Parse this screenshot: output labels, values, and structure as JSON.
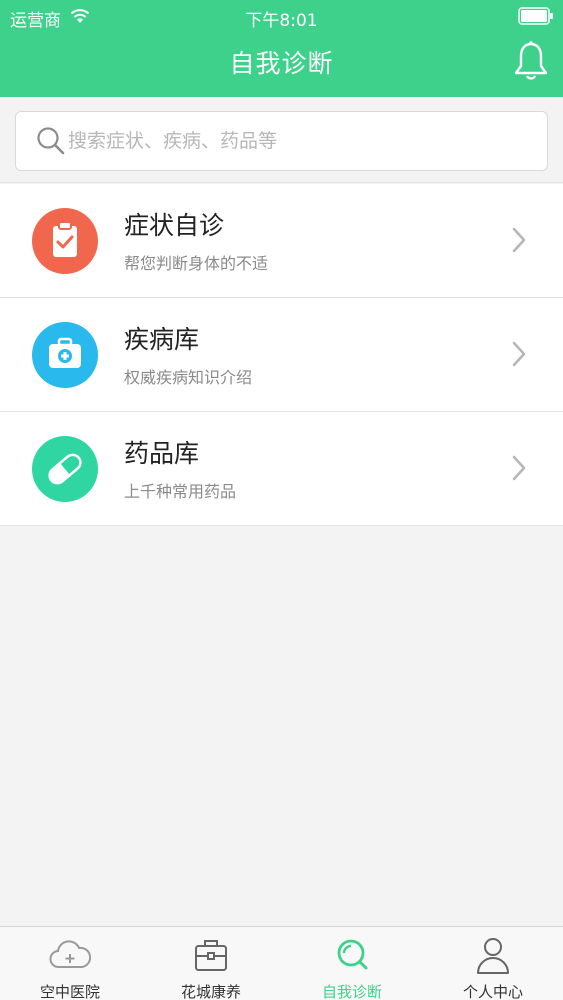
{
  "status_bar": {
    "carrier": "运营商",
    "time": "下午8:01"
  },
  "nav": {
    "title": "自我诊断",
    "bell_icon": "bell-icon"
  },
  "search": {
    "placeholder": "搜索症状、疾病、药品等",
    "value": ""
  },
  "items": [
    {
      "title": "症状自诊",
      "subtitle": "帮您判断身体的不适",
      "icon": "clipboard-check-icon",
      "color": "#f0674d"
    },
    {
      "title": "疾病库",
      "subtitle": "权威疾病知识介绍",
      "icon": "medical-kit-icon",
      "color": "#29b9ec"
    },
    {
      "title": "药品库",
      "subtitle": "上千种常用药品",
      "icon": "pill-icon",
      "color": "#2fd6a1"
    }
  ],
  "tabs": [
    {
      "label": "空中医院",
      "icon": "cloud-plus-icon",
      "active": false
    },
    {
      "label": "花城康养",
      "icon": "briefcase-icon",
      "active": false
    },
    {
      "label": "自我诊断",
      "icon": "search-icon",
      "active": true
    },
    {
      "label": "个人中心",
      "icon": "person-icon",
      "active": false
    }
  ],
  "colors": {
    "brand": "#3dd18b",
    "tab_inactive_icon": "#9a9a9a"
  }
}
